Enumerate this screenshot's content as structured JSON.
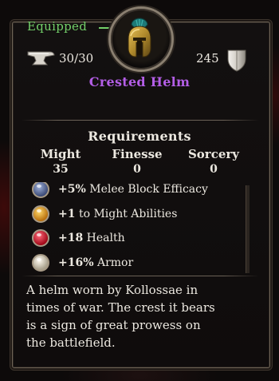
{
  "status_label": "Equipped",
  "item": {
    "icon": "crested-helm-icon",
    "name": "Crested Helm",
    "durability": "30/30",
    "armor": "245",
    "name_color": "#b35ee6"
  },
  "requirements": {
    "title": "Requirements",
    "stats": [
      {
        "name": "Might",
        "value": "35"
      },
      {
        "name": "Finesse",
        "value": "0"
      },
      {
        "name": "Sorcery",
        "value": "0"
      }
    ]
  },
  "modifiers": [
    {
      "icon": "shield-orb-icon",
      "value": "+5%",
      "text": "Melee Block Efficacy",
      "color": "#5d6e9c"
    },
    {
      "icon": "might-orb-icon",
      "value": "+1",
      "text": "to Might Abilities",
      "color": "#d08a1c"
    },
    {
      "icon": "health-orb-icon",
      "value": "+18",
      "text": "Health",
      "color": "#c8142a"
    },
    {
      "icon": "armor-orb-icon",
      "value": "+16%",
      "text": "Armor",
      "color": "#c9c2b0"
    }
  ],
  "description_lines": [
    "A helm worn by Kollossae in",
    "times of war. The crest it bears",
    "is a sign of great prowess on",
    "the battlefield."
  ],
  "colors": {
    "equipped": "#74d06a",
    "text": "#ece8e0",
    "frame": "#6e6456"
  }
}
